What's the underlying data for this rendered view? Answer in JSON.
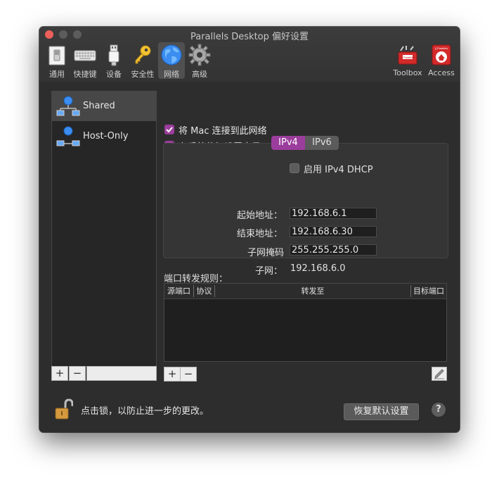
{
  "window": {
    "title": "Parallels Desktop 偏好设置"
  },
  "toolbar": {
    "items": [
      {
        "label": "通用",
        "icon": "switch-icon"
      },
      {
        "label": "快捷键",
        "icon": "keyboard-icon"
      },
      {
        "label": "设备",
        "icon": "usb-icon"
      },
      {
        "label": "安全性",
        "icon": "key-icon"
      },
      {
        "label": "网络",
        "icon": "globe-icon",
        "selected": true
      },
      {
        "label": "高级",
        "icon": "gear-icon"
      }
    ],
    "right_items": [
      {
        "label": "Toolbox",
        "icon": "toolbox-icon",
        "badge": "|| Parallels"
      },
      {
        "label": "Access",
        "icon": "access-icon",
        "badge": "|| Parallels"
      }
    ]
  },
  "networks": [
    {
      "label": "Shared",
      "selected": true
    },
    {
      "label": "Host-Only",
      "selected": false
    }
  ],
  "list_buttons": {
    "add": "+",
    "remove": "−"
  },
  "options": {
    "connect_mac": {
      "label": "将 Mac 连接到此网络",
      "checked": true
    },
    "show_in_prefs": {
      "label": "在系统偏好设置中显示",
      "checked": true
    }
  },
  "ip_tabs": [
    {
      "label": "IPv4",
      "active": true
    },
    {
      "label": "IPv6",
      "active": false
    }
  ],
  "ipv4": {
    "dhcp_label": "启用 IPv4 DHCP",
    "dhcp_checked": false,
    "start_label": "起始地址：",
    "start_value": "192.168.6.1",
    "end_label": "结束地址：",
    "end_value": "192.168.6.30",
    "mask_label": "子网掩码",
    "mask_value": "255.255.255.0",
    "subnet_label": "子网：",
    "subnet_value": "192.168.6.0"
  },
  "port_forwarding": {
    "title": "端口转发规则：",
    "columns": [
      "源端口",
      "协议",
      "转发至",
      "目标端口"
    ],
    "rows": []
  },
  "footer": {
    "lock_text": "点击锁，以防止进一步的更改。",
    "restore_button": "恢复默认设置",
    "help": "?"
  },
  "colors": {
    "accent": "#9b3d9c",
    "window_bg": "#2d2d2d",
    "close": "#ec5f5a"
  }
}
